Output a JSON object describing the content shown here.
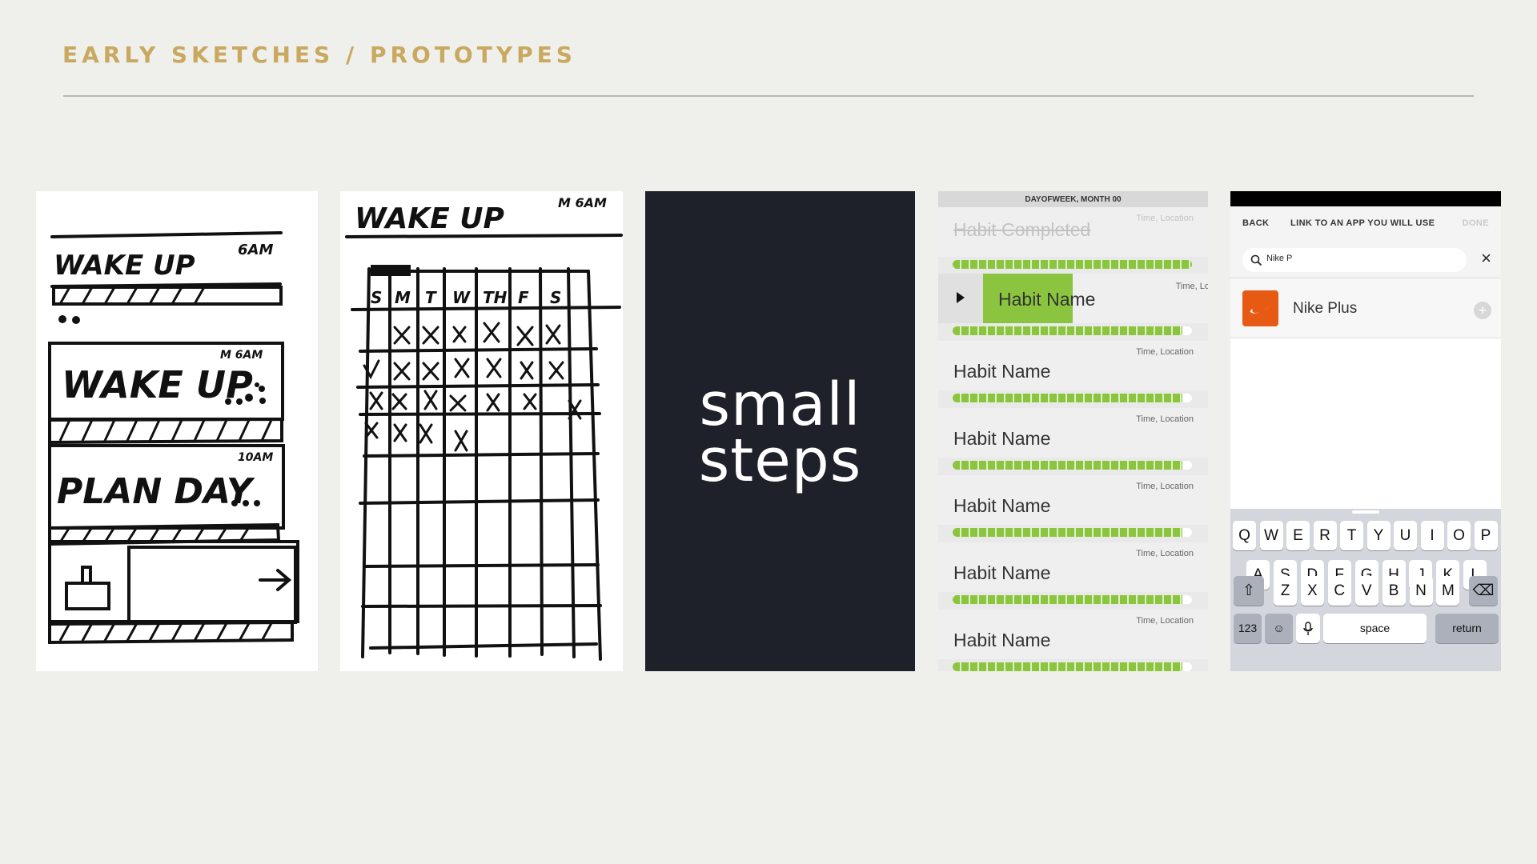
{
  "header": {
    "title": "EARLY SKETCHES / PROTOTYPES"
  },
  "sketch1": {
    "wake": "WAKE UP",
    "wake_time": "6AM",
    "wake2": "WAKE UP",
    "wake2_time": "M 6AM",
    "plan": "PLAN DAY",
    "plan_time": "10AM"
  },
  "sketch2": {
    "title": "WAKE UP",
    "time": "M 6AM",
    "days": [
      "S",
      "M",
      "T",
      "W",
      "TH",
      "F",
      "S"
    ]
  },
  "brand": {
    "line1": "small",
    "line2": "steps"
  },
  "habits": {
    "date_header": "DAYOFWEEK, MONTH 00",
    "completed": {
      "name": "Habit Completed",
      "meta": "Time, Location",
      "progress": 1.0
    },
    "active": {
      "name": "Habit Name",
      "meta": "Time, Lo",
      "progress": 0.96
    },
    "rows": [
      {
        "name": "Habit Name",
        "meta": "Time, Location",
        "progress": 0.96
      },
      {
        "name": "Habit Name",
        "meta": "Time, Location",
        "progress": 0.96
      },
      {
        "name": "Habit Name",
        "meta": "Time, Location",
        "progress": 0.96
      },
      {
        "name": "Habit Name",
        "meta": "Time, Location",
        "progress": 0.96
      },
      {
        "name": "Habit Name",
        "meta": "Time, Location",
        "progress": 0.96
      }
    ]
  },
  "linkapp": {
    "back": "BACK",
    "title": "LINK TO AN APP YOU WILL USE",
    "done": "DONE",
    "search_value": "Nike P",
    "clear": "×",
    "result_name": "Nike Plus",
    "add": "+",
    "keyboard": {
      "row1": [
        "Q",
        "W",
        "E",
        "R",
        "T",
        "Y",
        "U",
        "I",
        "O",
        "P"
      ],
      "row2": [
        "A",
        "S",
        "D",
        "F",
        "G",
        "H",
        "J",
        "K",
        "L"
      ],
      "row3": [
        "Z",
        "X",
        "C",
        "V",
        "B",
        "N",
        "M"
      ],
      "shift": "⇧",
      "backspace": "⌫",
      "numbers": "123",
      "emoji": "☺",
      "mic": "🎤",
      "space": "space",
      "return": "return"
    }
  },
  "colors": {
    "accent": "#c9a95f",
    "green": "#8bc53f",
    "dark": "#1f212a",
    "nike": "#e75a13"
  }
}
